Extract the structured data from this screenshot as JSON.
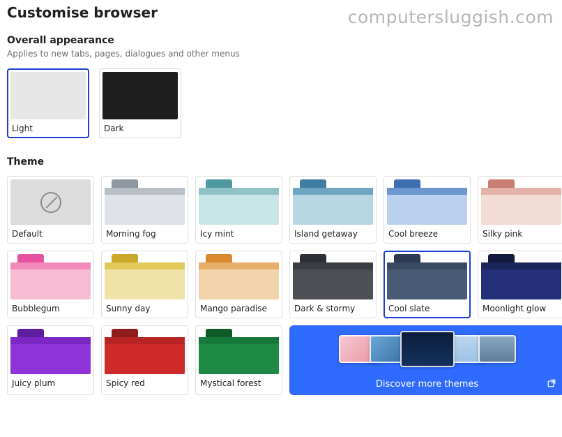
{
  "watermark": "computersluggish.com",
  "page_title": "Customise browser",
  "overall": {
    "title": "Overall appearance",
    "subtitle": "Applies to new tabs, pages, dialogues and other menus",
    "options": [
      {
        "id": "light",
        "label": "Light",
        "swatch": "#e6e6e6",
        "selected": true
      },
      {
        "id": "dark",
        "label": "Dark",
        "swatch": "#1e1e1e",
        "selected": false
      }
    ]
  },
  "theme": {
    "title": "Theme",
    "selected_id": "cool-slate",
    "items": [
      {
        "id": "default",
        "label": "Default",
        "tab": "#bfbfbf",
        "strip": "#cfcfcf",
        "body": "#dcdcdc",
        "is_default": true
      },
      {
        "id": "morning-fog",
        "label": "Morning fog",
        "tab": "#8f97a0",
        "strip": "#b9bfc6",
        "body": "#dfe3e7"
      },
      {
        "id": "icy-mint",
        "label": "Icy mint",
        "tab": "#4f9aa0",
        "strip": "#8fc3c6",
        "body": "#c9e6e6"
      },
      {
        "id": "island-getaway",
        "label": "Island getaway",
        "tab": "#3f7ea3",
        "strip": "#6fa5c0",
        "body": "#b7d7e4"
      },
      {
        "id": "cool-breeze",
        "label": "Cool breeze",
        "tab": "#3d6fb0",
        "strip": "#6c97cf",
        "body": "#b9d1ee"
      },
      {
        "id": "silky-pink",
        "label": "Silky pink",
        "tab": "#c97e73",
        "strip": "#e3b3a9",
        "body": "#f3dcd4"
      },
      {
        "id": "bubblegum",
        "label": "Bubblegum",
        "tab": "#e74fa0",
        "strip": "#f18ab8",
        "body": "#f7bcd4"
      },
      {
        "id": "sunny-day",
        "label": "Sunny day",
        "tab": "#c9a82a",
        "strip": "#e1c95a",
        "body": "#efe3a8"
      },
      {
        "id": "mango-paradise",
        "label": "Mango paradise",
        "tab": "#d98a2e",
        "strip": "#e7ae6a",
        "body": "#f1d4ab"
      },
      {
        "id": "dark-stormy",
        "label": "Dark & stormy",
        "tab": "#2c2f33",
        "strip": "#3a3d41",
        "body": "#4c4f53"
      },
      {
        "id": "cool-slate",
        "label": "Cool slate",
        "tab": "#2d3b52",
        "strip": "#3a4a63",
        "body": "#495a75"
      },
      {
        "id": "moonlight-glow",
        "label": "Moonlight glow",
        "tab": "#121a3d",
        "strip": "#1a265a",
        "body": "#233079"
      },
      {
        "id": "juicy-plum",
        "label": "Juicy plum",
        "tab": "#5e1d9e",
        "strip": "#7a27c4",
        "body": "#8f34d9"
      },
      {
        "id": "spicy-red",
        "label": "Spicy red",
        "tab": "#8e1c1c",
        "strip": "#b82323",
        "body": "#cf2b2b"
      },
      {
        "id": "mystical-forest",
        "label": "Mystical forest",
        "tab": "#0f5a26",
        "strip": "#16793a",
        "body": "#1f8a45"
      }
    ],
    "discover_label": "Discover more themes"
  }
}
